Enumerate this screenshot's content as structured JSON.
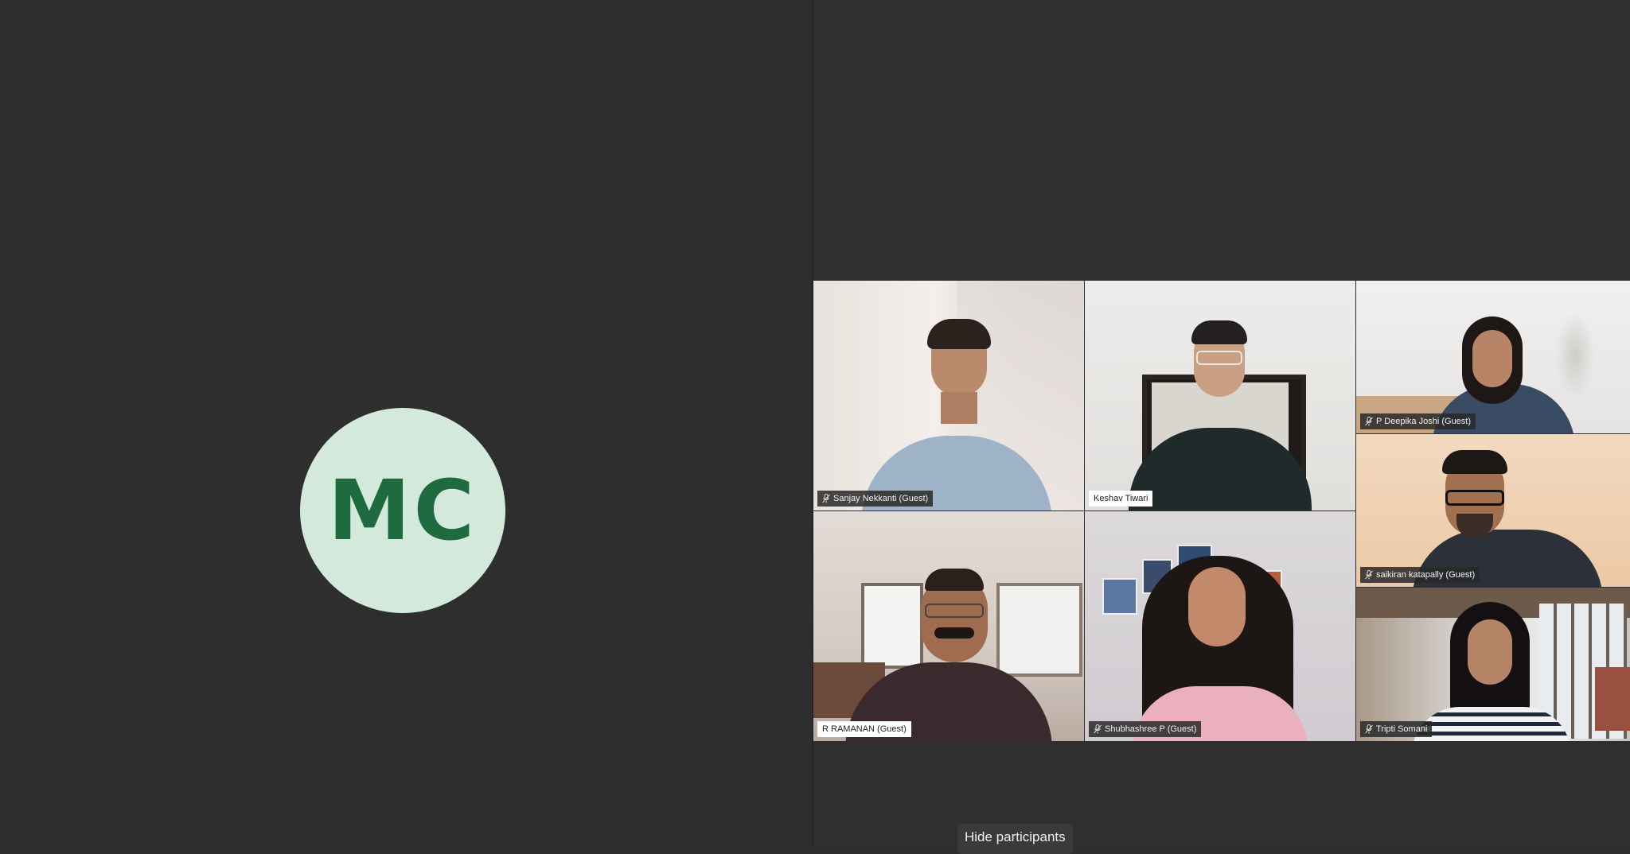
{
  "presenter": {
    "initials": "MC",
    "avatar_bg": "#d3e9dc",
    "avatar_fg": "#1d6b3e"
  },
  "participants": [
    {
      "name": "Sanjay Nekkanti (Guest)",
      "muted": true
    },
    {
      "name": "Keshav Tiwari",
      "muted": false
    },
    {
      "name": "P Deepika Joshi (Guest)",
      "muted": true
    },
    {
      "name": "saikiran katapally (Guest)",
      "muted": true
    },
    {
      "name": "R RAMANAN (Guest)",
      "muted": false
    },
    {
      "name": "Shubhashree P (Guest)",
      "muted": true
    },
    {
      "name": "Tripti Somani",
      "muted": true
    }
  ],
  "controls": {
    "hide_participants_label": "Hide participants"
  },
  "icons": {
    "mic_off": "mic-off-icon"
  }
}
